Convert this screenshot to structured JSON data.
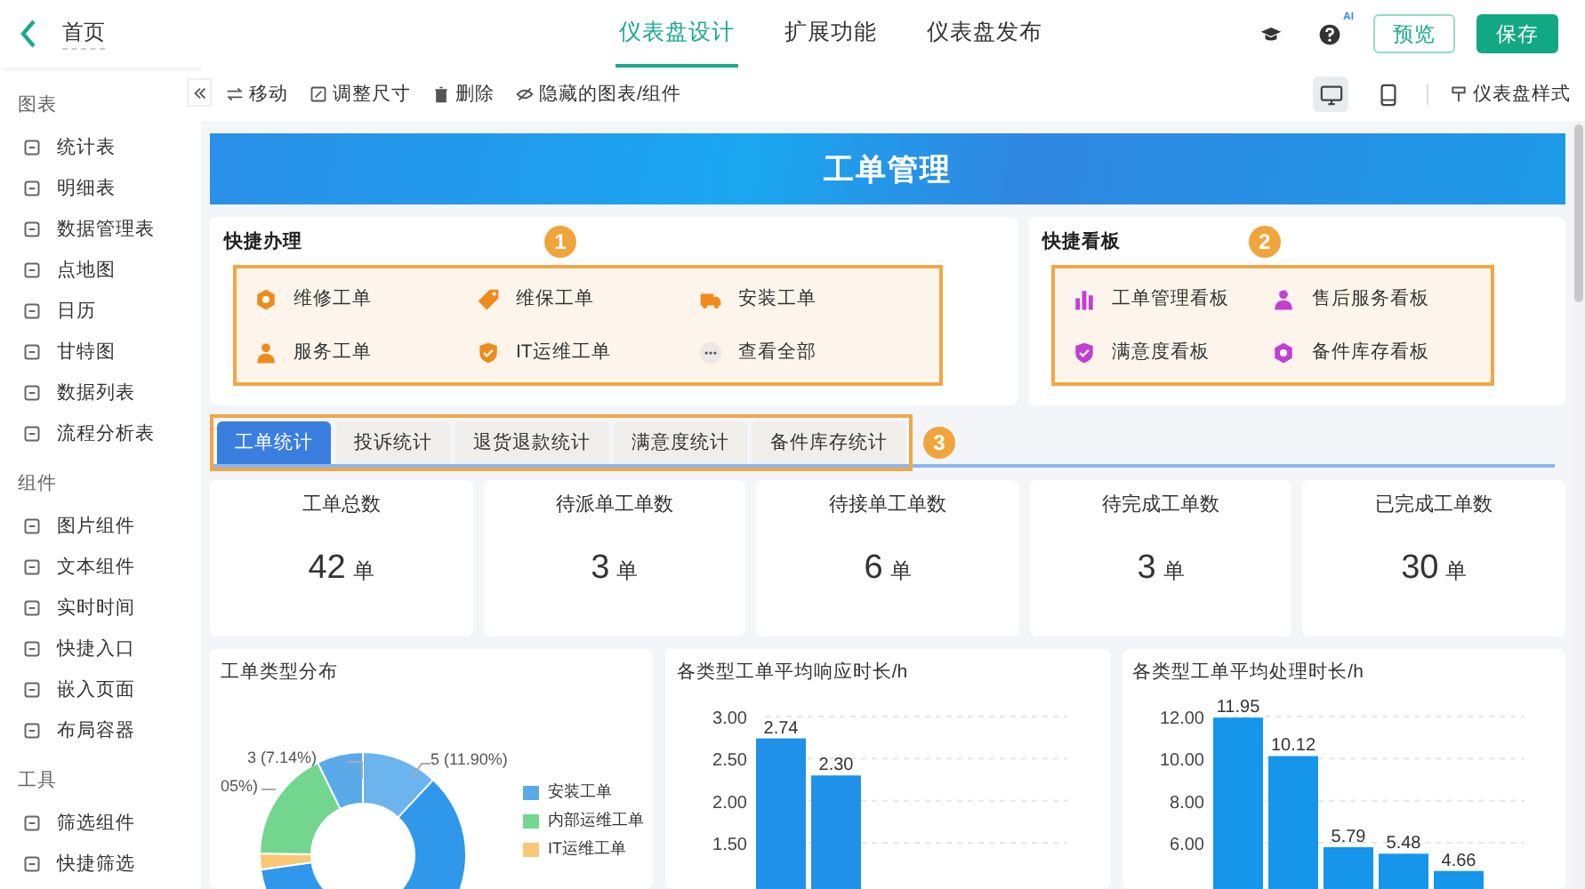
{
  "top_bar": {
    "back_label": "首页",
    "tabs": [
      {
        "label": "仪表盘设计",
        "selected": true
      },
      {
        "label": "扩展功能",
        "selected": false
      },
      {
        "label": "仪表盘发布",
        "selected": false
      }
    ],
    "ai_badge": "AI",
    "buttons": [
      {
        "label": "预览",
        "kind": "outline"
      },
      {
        "label": "保存",
        "kind": "primary"
      }
    ]
  },
  "sidebar": {
    "sections": [
      {
        "title": "图表",
        "items": [
          "统计表",
          "明细表",
          "数据管理表",
          "点地图",
          "日历",
          "甘特图",
          "数据列表",
          "流程分析表"
        ]
      },
      {
        "title": "组件",
        "items": [
          "图片组件",
          "文本组件",
          "实时时间",
          "快捷入口",
          "嵌入页面",
          "布局容器"
        ]
      },
      {
        "title": "工具",
        "items": [
          "筛选组件",
          "快捷筛选"
        ]
      }
    ]
  },
  "toolbar": {
    "actions": [
      "移动",
      "调整尺寸",
      "删除",
      "隐藏的图表/组件"
    ],
    "devices": [
      {
        "kind": "desktop",
        "selected": true
      },
      {
        "kind": "tablet",
        "selected": false
      }
    ],
    "style_label": "仪表盘样式"
  },
  "banner": {
    "title": "工单管理"
  },
  "quick_actions": {
    "title": "快捷办理",
    "marker": "1",
    "items": [
      "维修工单",
      "维保工单",
      "安装工单",
      "服务工单",
      "IT运维工单",
      "查看全部"
    ]
  },
  "quick_boards": {
    "title": "快捷看板",
    "marker": "2",
    "items": [
      "工单管理看板",
      "售后服务看板",
      "满意度看板",
      "备件库存看板"
    ]
  },
  "stat_tabs": {
    "marker": "3",
    "tabs": [
      {
        "label": "工单统计",
        "selected": true
      },
      {
        "label": "投诉统计",
        "selected": false
      },
      {
        "label": "退货退款统计",
        "selected": false
      },
      {
        "label": "满意度统计",
        "selected": false
      },
      {
        "label": "备件库存统计",
        "selected": false
      }
    ]
  },
  "kpis": [
    {
      "label": "工单总数",
      "value": "42",
      "unit": "单"
    },
    {
      "label": "待派单工单数",
      "value": "3",
      "unit": "单"
    },
    {
      "label": "待接单工单数",
      "value": "6",
      "unit": "单"
    },
    {
      "label": "待完成工单数",
      "value": "3",
      "unit": "单"
    },
    {
      "label": "已完成工单数",
      "value": "30",
      "unit": "单"
    }
  ],
  "type_distribution": {
    "title": "工单类型分布",
    "slice_labels": [
      "05%)",
      "3 (7.14%)",
      "5 (11.90%)"
    ],
    "legend": [
      {
        "label": "安装工单",
        "color": "#5aaaea"
      },
      {
        "label": "内部运维工单",
        "color": "#73d68e"
      },
      {
        "label": "IT运维工单",
        "color": "#f8c875"
      }
    ]
  },
  "response_chart": {
    "title": "各类型工单平均响应时长/h",
    "chart_data": {
      "type": "bar",
      "series": [
        {
          "color": "#1f91e8",
          "values": [
            2.74,
            2.3
          ]
        }
      ],
      "ylim": [
        0,
        3
      ],
      "yticks": [
        {
          "value": 1.5,
          "label": "1.50"
        },
        {
          "value": 2,
          "label": "2.00"
        },
        {
          "value": 2.5,
          "label": "2.50"
        },
        {
          "value": 3,
          "label": "3.00"
        }
      ],
      "grid": true,
      "value_labels": [
        "2.74",
        "2.30"
      ]
    }
  },
  "handling_chart": {
    "title": "各类型工单平均处理时长/h",
    "chart_data": {
      "type": "bar",
      "series": [
        {
          "color": "#1596ea",
          "values": [
            11.95,
            10.12,
            5.79,
            5.48,
            4.66
          ]
        }
      ],
      "ylim": [
        0,
        12
      ],
      "yticks": [
        {
          "value": 6,
          "label": "6.00"
        },
        {
          "value": 8,
          "label": "8.00"
        },
        {
          "value": 10,
          "label": "10.00"
        },
        {
          "value": 12,
          "label": "12.00"
        }
      ],
      "grid": true,
      "value_labels": [
        "11.95",
        "10.12",
        "5.79",
        "5.48",
        "4.66"
      ]
    }
  }
}
